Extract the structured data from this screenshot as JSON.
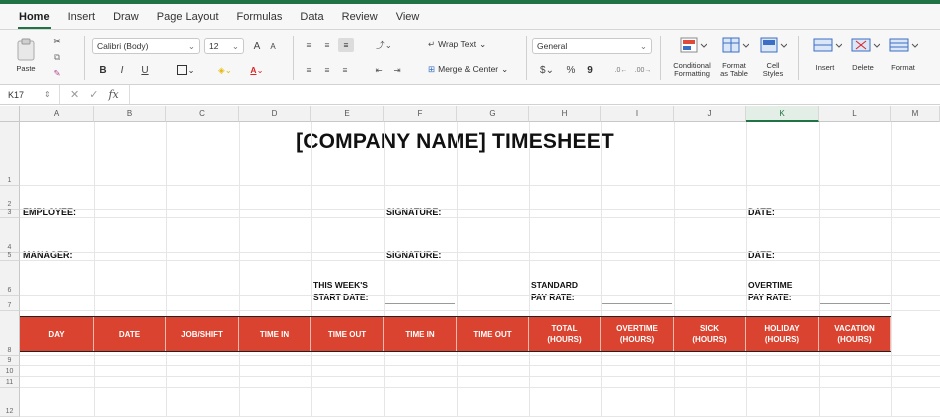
{
  "ribbon_tabs": [
    "Home",
    "Insert",
    "Draw",
    "Page Layout",
    "Formulas",
    "Data",
    "Review",
    "View"
  ],
  "clipboard": {
    "paste": "Paste"
  },
  "font": {
    "name": "Calibri (Body)",
    "size": "12",
    "grow": "A",
    "shrink": "A",
    "bold": "B",
    "italic": "I",
    "underline": "U"
  },
  "alignment": {
    "wrap_text": "Wrap Text",
    "merge_center": "Merge & Center"
  },
  "number": {
    "format": "General",
    "currency": "$",
    "percent": "%",
    "comma": "9"
  },
  "styles": {
    "conditional": "Conditional\nFormatting",
    "format_table": "Format\nas Table",
    "cell_styles": "Cell\nStyles"
  },
  "cells": {
    "insert": "Insert",
    "delete": "Delete",
    "format": "Format"
  },
  "formula_bar": {
    "cell_ref": "K17",
    "fx": "fx",
    "value": ""
  },
  "columns": [
    "A",
    "B",
    "C",
    "D",
    "E",
    "F",
    "G",
    "H",
    "I",
    "J",
    "K",
    "L",
    "M"
  ],
  "selected_column": "K",
  "rows": [
    "1",
    "2",
    "3",
    "4",
    "5",
    "6",
    "7",
    "8",
    "9",
    "10",
    "11",
    "12"
  ],
  "sheet": {
    "title": "[COMPANY NAME] TIMESHEET",
    "employee_label": "EMPLOYEE:",
    "manager_label": "MANAGER:",
    "signature_label_1": "SIGNATURE:",
    "signature_label_2": "SIGNATURE:",
    "date_label_1": "DATE:",
    "date_label_2": "DATE:",
    "week_start_line1": "THIS WEEK'S",
    "week_start_line2": "START DATE:",
    "std_pay_line1": "STANDARD",
    "std_pay_line2": "PAY RATE:",
    "ot_pay_line1": "OVERTIME",
    "ot_pay_line2": "PAY RATE:",
    "headers": [
      [
        "DAY",
        ""
      ],
      [
        "DATE",
        ""
      ],
      [
        "JOB/SHIFT",
        ""
      ],
      [
        "TIME IN",
        ""
      ],
      [
        "TIME OUT",
        ""
      ],
      [
        "TIME IN",
        ""
      ],
      [
        "TIME OUT",
        ""
      ],
      [
        "TOTAL",
        "(HOURS)"
      ],
      [
        "OVERTIME",
        "(HOURS)"
      ],
      [
        "SICK",
        "(HOURS)"
      ],
      [
        "HOLIDAY",
        "(HOURS)"
      ],
      [
        "VACATION",
        "(HOURS)"
      ]
    ]
  },
  "colors": {
    "accent": "#217346",
    "header_fill": "#d9432f",
    "header_text": "#ffffff"
  }
}
